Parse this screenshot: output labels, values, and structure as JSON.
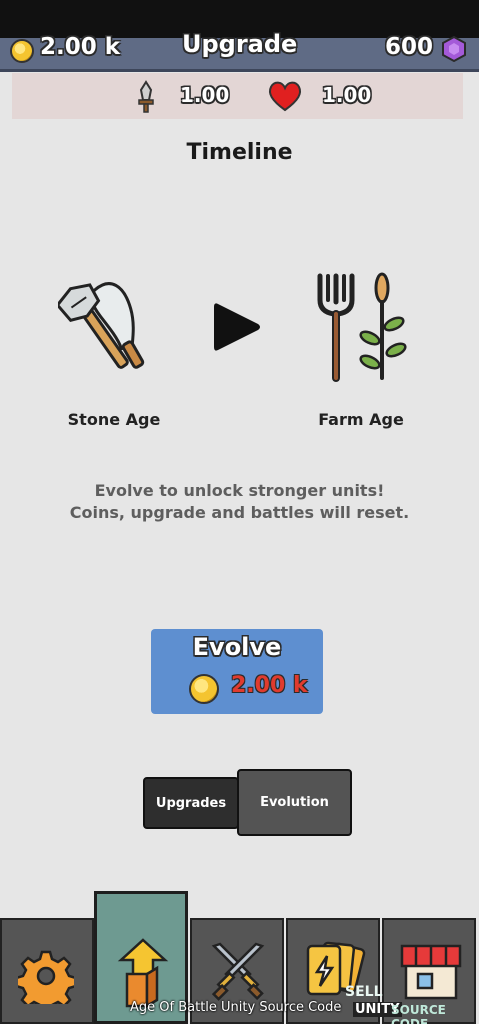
{
  "header": {
    "coins": "2.00 k",
    "title": "Upgrade",
    "gems": "600"
  },
  "stats": {
    "attack": "1.00",
    "health": "1.00"
  },
  "timeline": {
    "title": "Timeline",
    "current_age": "Stone Age",
    "next_age": "Farm Age",
    "description_line1": "Evolve to unlock stronger units!",
    "description_line2": "Coins, upgrade and battles will reset."
  },
  "evolve_button": {
    "label": "Evolve",
    "cost": "2.00 k"
  },
  "tabs": [
    {
      "label": "Upgrades",
      "selected": false
    },
    {
      "label": "Evolution",
      "selected": true
    }
  ],
  "bottom_nav": [
    {
      "icon": "gear-icon"
    },
    {
      "icon": "upgrade-arrow-icon",
      "active": true
    },
    {
      "icon": "crossed-swords-icon"
    },
    {
      "icon": "cards-icon"
    },
    {
      "icon": "shop-icon"
    }
  ],
  "watermark": {
    "caption": "Age Of Battle Unity Source Code",
    "logo_line1": "SELL",
    "logo_line2": "UNITY",
    "logo_line3": "SOURCE CODE"
  },
  "colors": {
    "header_bg": "#5f6b85",
    "evolve_button_bg": "#5e8fd0",
    "cost_red": "#e03b2e",
    "active_nav_bg": "#6e9a91"
  }
}
